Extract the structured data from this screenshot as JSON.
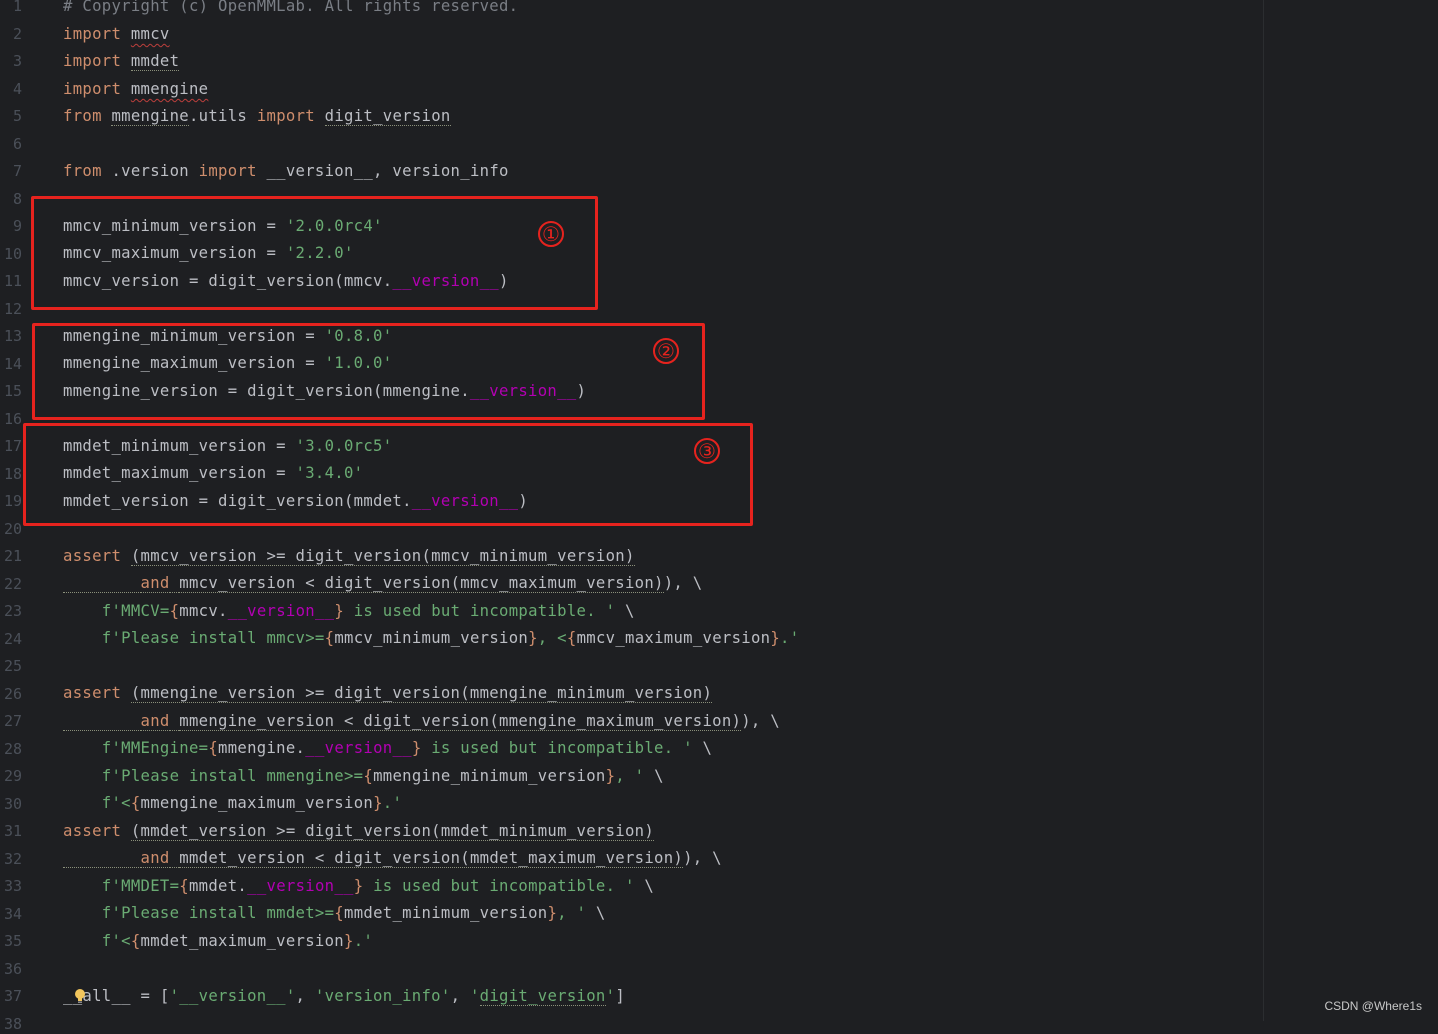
{
  "watermark": "CSDN @Where1s",
  "annotations": [
    "①",
    "②",
    "③"
  ],
  "line_numbers": [
    "1",
    "2",
    "3",
    "4",
    "5",
    "6",
    "7",
    "8",
    "9",
    "10",
    "11",
    "12",
    "13",
    "14",
    "15",
    "16",
    "17",
    "18",
    "19",
    "20",
    "21",
    "22",
    "23",
    "24",
    "25",
    "26",
    "27",
    "28",
    "29",
    "30",
    "31",
    "32",
    "33",
    "34",
    "35",
    "36",
    "37",
    "38"
  ],
  "code": {
    "l1": "# Copyright (c) OpenMMLab. All rights reserved.",
    "kw_import": "import",
    "kw_from": "from",
    "kw_assert": "assert",
    "kw_and": "and",
    "mmcv": "mmcv",
    "mmdet": "mmdet",
    "mmengine": "mmengine",
    "utils": ".utils ",
    "digit_version": "digit_version",
    "version_mod": " .version ",
    "version_tail": " __version__, version_info",
    "l9_a": "mmcv_minimum_version = ",
    "l9_s": "'2.0.0rc4'",
    "l10_a": "mmcv_maximum_version = ",
    "l10_s": "'2.2.0'",
    "l11_a": "mmcv_version = digit_version(mmcv.",
    "dunder_version": "__version__",
    "close_paren": ")",
    "l13_a": "mmengine_minimum_version = ",
    "l13_s": "'0.8.0'",
    "l14_a": "mmengine_maximum_version = ",
    "l14_s": "'1.0.0'",
    "l15_a": "mmengine_version = digit_version(mmengine.",
    "l17_a": "mmdet_minimum_version = ",
    "l17_s": "'3.0.0rc5'",
    "l18_a": "mmdet_maximum_version = ",
    "l18_s": "'3.4.0'",
    "l19_a": "mmdet_version = digit_version(mmdet.",
    "l21_b": "(mmcv_version >= digit_version(mmcv_minimum_version)",
    "l22_b": "mmcv_version < digit_version(mmcv_maximum_version)",
    "l22_tail": "), \\",
    "l23_f": "f'MMCV=",
    "l23_m": "mmcv.",
    "l23_s": " is used but incompatible. '",
    "l23_tail": " \\",
    "l24_f": "f'Please install mmcv>=",
    "l24_m1": "mmcv_minimum_version",
    "l24_sep": ", <",
    "l24_m2": "mmcv_maximum_version",
    "l24_end": ".'",
    "l26_b": "(mmengine_version >= digit_version(mmengine_minimum_version)",
    "l27_b": "mmengine_version < digit_version(mmengine_maximum_version)",
    "l28_f": "f'MMEngine=",
    "l28_m": "mmengine.",
    "l29_f": "f'Please install mmengine>=",
    "l29_m": "mmengine_minimum_version",
    "l29_s": ", '",
    "l30_f": "f'<",
    "l30_m": "mmengine_maximum_version",
    "l31_b": "(mmdet_version >= digit_version(mmdet_minimum_version)",
    "l32_b": "mmdet_version < digit_version(mmdet_maximum_version)",
    "l33_f": "f'MMDET=",
    "l33_m": "mmdet.",
    "l34_f": "f'Please install mmdet>=",
    "l34_m": "mmdet_minimum_version",
    "l35_m": "mmdet_maximum_version",
    "l37_a": "__all__ = [",
    "l37_s1": "'__version__'",
    "l37_s2": "'version_info'",
    "l37_s3a": "'",
    "l37_s3b": "'",
    "l37_end": "]",
    "comma": ", ",
    "eq": "=",
    "lbrace": "{",
    "rbrace": "}",
    "paren_open": "(",
    "indent_and": "        ",
    "indent_f": "    ",
    "space": " "
  }
}
